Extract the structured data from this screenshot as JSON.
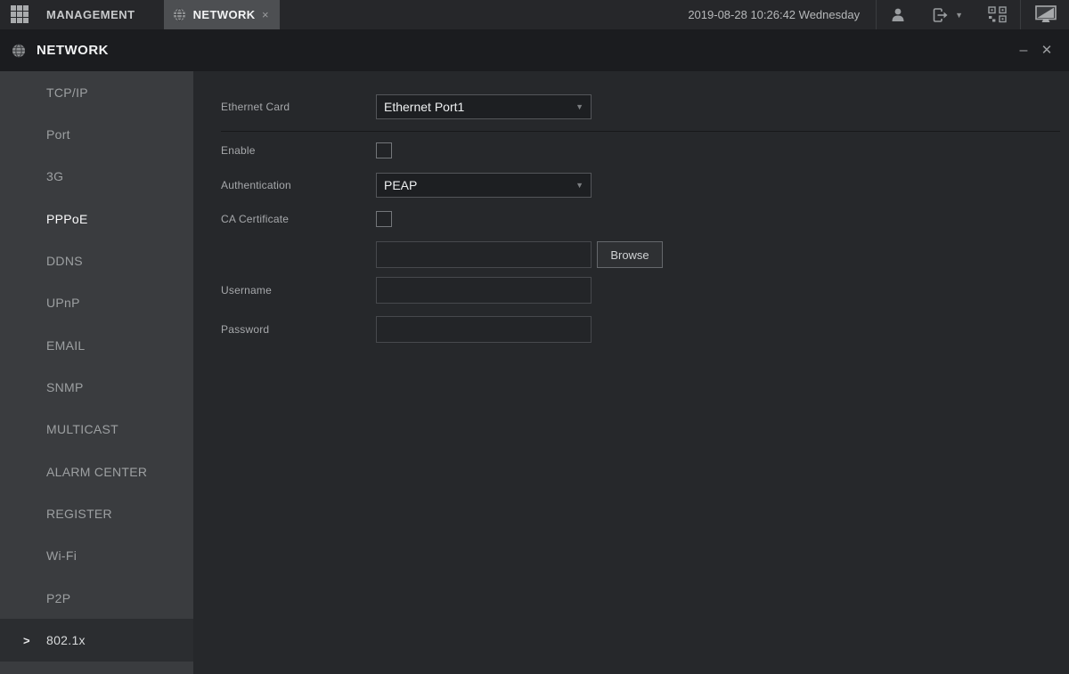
{
  "topbar": {
    "home_label": "MANAGEMENT",
    "tab": {
      "label": "NETWORK",
      "close_glyph": "×"
    },
    "datetime": "2019-08-28 10:26:42 Wednesday",
    "icons": [
      "user-icon",
      "logout-icon",
      "chevron-down-icon",
      "qr-code-icon",
      "display-icon"
    ]
  },
  "window": {
    "title": "NETWORK",
    "minimize_glyph": "–",
    "close_glyph": "✕"
  },
  "sidebar": {
    "items": [
      {
        "label": "TCP/IP"
      },
      {
        "label": "Port"
      },
      {
        "label": "3G"
      },
      {
        "label": "PPPoE",
        "highlighted": true
      },
      {
        "label": "DDNS"
      },
      {
        "label": "UPnP"
      },
      {
        "label": "EMAIL"
      },
      {
        "label": "SNMP"
      },
      {
        "label": "MULTICAST"
      },
      {
        "label": "ALARM CENTER"
      },
      {
        "label": "REGISTER"
      },
      {
        "label": "Wi-Fi"
      },
      {
        "label": "P2P"
      },
      {
        "label": "802.1x",
        "selected": true
      }
    ],
    "selected_arrow_glyph": ">"
  },
  "form": {
    "ethernet_card": {
      "label": "Ethernet Card",
      "value": "Ethernet Port1",
      "arrow_glyph": "▼"
    },
    "enable": {
      "label": "Enable",
      "checked": false
    },
    "authentication": {
      "label": "Authentication",
      "value": "PEAP",
      "arrow_glyph": "▼"
    },
    "ca_certificate": {
      "label": "CA Certificate",
      "checked": false
    },
    "ca_file": {
      "value": "",
      "browse_label": "Browse"
    },
    "username": {
      "label": "Username",
      "value": ""
    },
    "password": {
      "label": "Password",
      "value": ""
    }
  },
  "colors": {
    "topbar_bg": "#26272a",
    "tab_active_bg": "#4d4f52",
    "window_header_bg": "#1b1c1f",
    "sidebar_bg": "#3a3c3f",
    "sidebar_selected_bg": "#2b2d30",
    "content_bg": "#26282b",
    "field_border": "#54565a",
    "text_primary": "#eef0f1",
    "text_secondary": "#a6a8ab"
  }
}
